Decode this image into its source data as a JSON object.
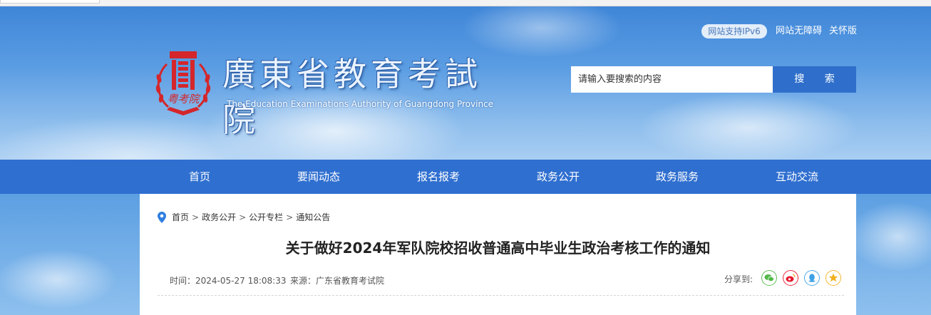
{
  "header": {
    "util_links": [
      "网站支持IPv6",
      "网站无障碍",
      "关怀版"
    ],
    "logo_title": "廣東省教育考試院",
    "logo_subtitle": "The Education Examinations Authority of Guangdong Province",
    "emblem_text": "粤考院",
    "search": {
      "placeholder": "请输入要搜索的内容",
      "button_label": "搜 索"
    }
  },
  "nav": {
    "items": [
      "首页",
      "要闻动态",
      "报名报考",
      "政务公开",
      "政务服务",
      "互动交流"
    ]
  },
  "breadcrumb": [
    "首页",
    "政务公开",
    "公开专栏",
    "通知公告"
  ],
  "breadcrumb_separator": ">",
  "article": {
    "title": "关于做好2024年军队院校招收普通高中毕业生政治考核工作的通知",
    "time_label": "时间：",
    "time_value": "2024-05-27 18:08:33",
    "source_label": "来源：",
    "source_value": "广东省教育考试院",
    "share_label": "分享到:"
  },
  "share_icons": [
    "wechat-icon",
    "weibo-icon",
    "qq-icon",
    "qzone-icon"
  ],
  "colors": {
    "nav_bg": "#2f6fd0",
    "search_button": "#2f6fcb",
    "emblem_red": "#d4262b",
    "wechat": "#52b848",
    "weibo": "#e6162d",
    "qq": "#3ea0e6",
    "qzone": "#f2b01e"
  }
}
